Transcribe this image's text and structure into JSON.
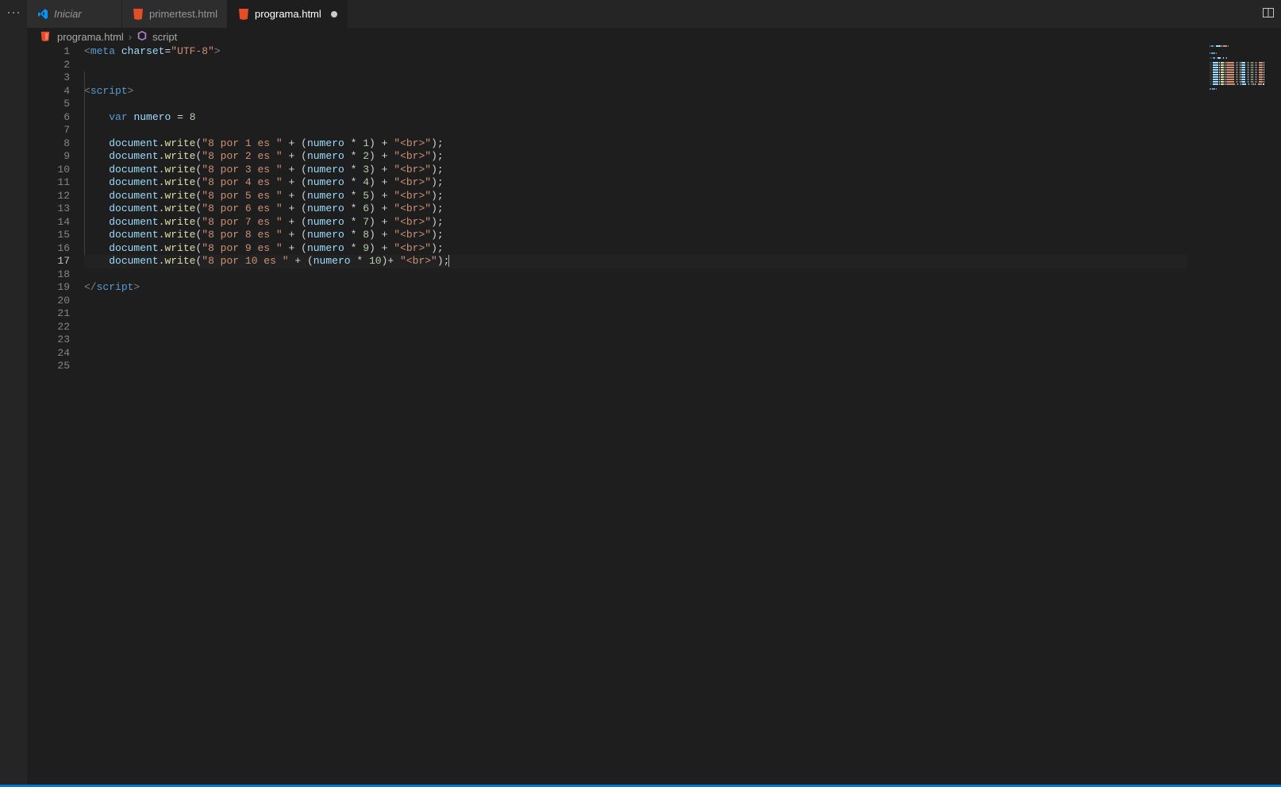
{
  "tabs": [
    {
      "label": "Iniciar",
      "icon": "vscode",
      "italic": true,
      "active": false,
      "dirty": false
    },
    {
      "label": "primertest.html",
      "icon": "html",
      "italic": false,
      "active": false,
      "dirty": false
    },
    {
      "label": "programa.html",
      "icon": "html",
      "italic": false,
      "active": true,
      "dirty": true
    }
  ],
  "breadcrumbs": {
    "file_icon": "html",
    "file": "programa.html",
    "symbol_icon": "cube",
    "symbol": "script"
  },
  "editor": {
    "current_line": 17,
    "total_lines": 25,
    "code_lines": [
      {
        "n": 1,
        "tokens": [
          {
            "c": "tk-tag",
            "t": "<"
          },
          {
            "c": "tk-tagname",
            "t": "meta"
          },
          {
            "c": "tk-plain",
            "t": " "
          },
          {
            "c": "tk-attr",
            "t": "charset"
          },
          {
            "c": "tk-op",
            "t": "="
          },
          {
            "c": "tk-str",
            "t": "\"UTF-8\""
          },
          {
            "c": "tk-tag",
            "t": ">"
          }
        ]
      },
      {
        "n": 2,
        "tokens": []
      },
      {
        "n": 3,
        "tokens": []
      },
      {
        "n": 4,
        "tokens": [
          {
            "c": "tk-tag",
            "t": "<"
          },
          {
            "c": "tk-tagname",
            "t": "script"
          },
          {
            "c": "tk-tag",
            "t": ">"
          }
        ]
      },
      {
        "n": 5,
        "tokens": []
      },
      {
        "n": 6,
        "tokens": [
          {
            "c": "tk-plain",
            "t": "    "
          },
          {
            "c": "tk-kw",
            "t": "var"
          },
          {
            "c": "tk-plain",
            "t": " "
          },
          {
            "c": "tk-var",
            "t": "numero"
          },
          {
            "c": "tk-plain",
            "t": " "
          },
          {
            "c": "tk-op",
            "t": "="
          },
          {
            "c": "tk-plain",
            "t": " "
          },
          {
            "c": "tk-num",
            "t": "8"
          }
        ]
      },
      {
        "n": 7,
        "tokens": []
      },
      {
        "n": 8,
        "tokens": [
          {
            "c": "tk-plain",
            "t": "    "
          },
          {
            "c": "tk-obj",
            "t": "document"
          },
          {
            "c": "tk-punc",
            "t": "."
          },
          {
            "c": "tk-fn",
            "t": "write"
          },
          {
            "c": "tk-punc",
            "t": "("
          },
          {
            "c": "tk-str",
            "t": "\"8 por 1 es \""
          },
          {
            "c": "tk-plain",
            "t": " "
          },
          {
            "c": "tk-op",
            "t": "+"
          },
          {
            "c": "tk-plain",
            "t": " "
          },
          {
            "c": "tk-punc",
            "t": "("
          },
          {
            "c": "tk-var",
            "t": "numero"
          },
          {
            "c": "tk-plain",
            "t": " "
          },
          {
            "c": "tk-op",
            "t": "*"
          },
          {
            "c": "tk-plain",
            "t": " "
          },
          {
            "c": "tk-num",
            "t": "1"
          },
          {
            "c": "tk-punc",
            "t": ")"
          },
          {
            "c": "tk-plain",
            "t": " "
          },
          {
            "c": "tk-op",
            "t": "+"
          },
          {
            "c": "tk-plain",
            "t": " "
          },
          {
            "c": "tk-str",
            "t": "\"<br>\""
          },
          {
            "c": "tk-punc",
            "t": ");"
          }
        ]
      },
      {
        "n": 9,
        "tokens": [
          {
            "c": "tk-plain",
            "t": "    "
          },
          {
            "c": "tk-obj",
            "t": "document"
          },
          {
            "c": "tk-punc",
            "t": "."
          },
          {
            "c": "tk-fn",
            "t": "write"
          },
          {
            "c": "tk-punc",
            "t": "("
          },
          {
            "c": "tk-str",
            "t": "\"8 por 2 es \""
          },
          {
            "c": "tk-plain",
            "t": " "
          },
          {
            "c": "tk-op",
            "t": "+"
          },
          {
            "c": "tk-plain",
            "t": " "
          },
          {
            "c": "tk-punc",
            "t": "("
          },
          {
            "c": "tk-var",
            "t": "numero"
          },
          {
            "c": "tk-plain",
            "t": " "
          },
          {
            "c": "tk-op",
            "t": "*"
          },
          {
            "c": "tk-plain",
            "t": " "
          },
          {
            "c": "tk-num",
            "t": "2"
          },
          {
            "c": "tk-punc",
            "t": ")"
          },
          {
            "c": "tk-plain",
            "t": " "
          },
          {
            "c": "tk-op",
            "t": "+"
          },
          {
            "c": "tk-plain",
            "t": " "
          },
          {
            "c": "tk-str",
            "t": "\"<br>\""
          },
          {
            "c": "tk-punc",
            "t": ");"
          }
        ]
      },
      {
        "n": 10,
        "tokens": [
          {
            "c": "tk-plain",
            "t": "    "
          },
          {
            "c": "tk-obj",
            "t": "document"
          },
          {
            "c": "tk-punc",
            "t": "."
          },
          {
            "c": "tk-fn",
            "t": "write"
          },
          {
            "c": "tk-punc",
            "t": "("
          },
          {
            "c": "tk-str",
            "t": "\"8 por 3 es \""
          },
          {
            "c": "tk-plain",
            "t": " "
          },
          {
            "c": "tk-op",
            "t": "+"
          },
          {
            "c": "tk-plain",
            "t": " "
          },
          {
            "c": "tk-punc",
            "t": "("
          },
          {
            "c": "tk-var",
            "t": "numero"
          },
          {
            "c": "tk-plain",
            "t": " "
          },
          {
            "c": "tk-op",
            "t": "*"
          },
          {
            "c": "tk-plain",
            "t": " "
          },
          {
            "c": "tk-num",
            "t": "3"
          },
          {
            "c": "tk-punc",
            "t": ")"
          },
          {
            "c": "tk-plain",
            "t": " "
          },
          {
            "c": "tk-op",
            "t": "+"
          },
          {
            "c": "tk-plain",
            "t": " "
          },
          {
            "c": "tk-str",
            "t": "\"<br>\""
          },
          {
            "c": "tk-punc",
            "t": ");"
          }
        ]
      },
      {
        "n": 11,
        "tokens": [
          {
            "c": "tk-plain",
            "t": "    "
          },
          {
            "c": "tk-obj",
            "t": "document"
          },
          {
            "c": "tk-punc",
            "t": "."
          },
          {
            "c": "tk-fn",
            "t": "write"
          },
          {
            "c": "tk-punc",
            "t": "("
          },
          {
            "c": "tk-str",
            "t": "\"8 por 4 es \""
          },
          {
            "c": "tk-plain",
            "t": " "
          },
          {
            "c": "tk-op",
            "t": "+"
          },
          {
            "c": "tk-plain",
            "t": " "
          },
          {
            "c": "tk-punc",
            "t": "("
          },
          {
            "c": "tk-var",
            "t": "numero"
          },
          {
            "c": "tk-plain",
            "t": " "
          },
          {
            "c": "tk-op",
            "t": "*"
          },
          {
            "c": "tk-plain",
            "t": " "
          },
          {
            "c": "tk-num",
            "t": "4"
          },
          {
            "c": "tk-punc",
            "t": ")"
          },
          {
            "c": "tk-plain",
            "t": " "
          },
          {
            "c": "tk-op",
            "t": "+"
          },
          {
            "c": "tk-plain",
            "t": " "
          },
          {
            "c": "tk-str",
            "t": "\"<br>\""
          },
          {
            "c": "tk-punc",
            "t": ");"
          }
        ]
      },
      {
        "n": 12,
        "tokens": [
          {
            "c": "tk-plain",
            "t": "    "
          },
          {
            "c": "tk-obj",
            "t": "document"
          },
          {
            "c": "tk-punc",
            "t": "."
          },
          {
            "c": "tk-fn",
            "t": "write"
          },
          {
            "c": "tk-punc",
            "t": "("
          },
          {
            "c": "tk-str",
            "t": "\"8 por 5 es \""
          },
          {
            "c": "tk-plain",
            "t": " "
          },
          {
            "c": "tk-op",
            "t": "+"
          },
          {
            "c": "tk-plain",
            "t": " "
          },
          {
            "c": "tk-punc",
            "t": "("
          },
          {
            "c": "tk-var",
            "t": "numero"
          },
          {
            "c": "tk-plain",
            "t": " "
          },
          {
            "c": "tk-op",
            "t": "*"
          },
          {
            "c": "tk-plain",
            "t": " "
          },
          {
            "c": "tk-num",
            "t": "5"
          },
          {
            "c": "tk-punc",
            "t": ")"
          },
          {
            "c": "tk-plain",
            "t": " "
          },
          {
            "c": "tk-op",
            "t": "+"
          },
          {
            "c": "tk-plain",
            "t": " "
          },
          {
            "c": "tk-str",
            "t": "\"<br>\""
          },
          {
            "c": "tk-punc",
            "t": ");"
          }
        ]
      },
      {
        "n": 13,
        "tokens": [
          {
            "c": "tk-plain",
            "t": "    "
          },
          {
            "c": "tk-obj",
            "t": "document"
          },
          {
            "c": "tk-punc",
            "t": "."
          },
          {
            "c": "tk-fn",
            "t": "write"
          },
          {
            "c": "tk-punc",
            "t": "("
          },
          {
            "c": "tk-str",
            "t": "\"8 por 6 es \""
          },
          {
            "c": "tk-plain",
            "t": " "
          },
          {
            "c": "tk-op",
            "t": "+"
          },
          {
            "c": "tk-plain",
            "t": " "
          },
          {
            "c": "tk-punc",
            "t": "("
          },
          {
            "c": "tk-var",
            "t": "numero"
          },
          {
            "c": "tk-plain",
            "t": " "
          },
          {
            "c": "tk-op",
            "t": "*"
          },
          {
            "c": "tk-plain",
            "t": " "
          },
          {
            "c": "tk-num",
            "t": "6"
          },
          {
            "c": "tk-punc",
            "t": ")"
          },
          {
            "c": "tk-plain",
            "t": " "
          },
          {
            "c": "tk-op",
            "t": "+"
          },
          {
            "c": "tk-plain",
            "t": " "
          },
          {
            "c": "tk-str",
            "t": "\"<br>\""
          },
          {
            "c": "tk-punc",
            "t": ");"
          }
        ]
      },
      {
        "n": 14,
        "tokens": [
          {
            "c": "tk-plain",
            "t": "    "
          },
          {
            "c": "tk-obj",
            "t": "document"
          },
          {
            "c": "tk-punc",
            "t": "."
          },
          {
            "c": "tk-fn",
            "t": "write"
          },
          {
            "c": "tk-punc",
            "t": "("
          },
          {
            "c": "tk-str",
            "t": "\"8 por 7 es \""
          },
          {
            "c": "tk-plain",
            "t": " "
          },
          {
            "c": "tk-op",
            "t": "+"
          },
          {
            "c": "tk-plain",
            "t": " "
          },
          {
            "c": "tk-punc",
            "t": "("
          },
          {
            "c": "tk-var",
            "t": "numero"
          },
          {
            "c": "tk-plain",
            "t": " "
          },
          {
            "c": "tk-op",
            "t": "*"
          },
          {
            "c": "tk-plain",
            "t": " "
          },
          {
            "c": "tk-num",
            "t": "7"
          },
          {
            "c": "tk-punc",
            "t": ")"
          },
          {
            "c": "tk-plain",
            "t": " "
          },
          {
            "c": "tk-op",
            "t": "+"
          },
          {
            "c": "tk-plain",
            "t": " "
          },
          {
            "c": "tk-str",
            "t": "\"<br>\""
          },
          {
            "c": "tk-punc",
            "t": ");"
          }
        ]
      },
      {
        "n": 15,
        "tokens": [
          {
            "c": "tk-plain",
            "t": "    "
          },
          {
            "c": "tk-obj",
            "t": "document"
          },
          {
            "c": "tk-punc",
            "t": "."
          },
          {
            "c": "tk-fn",
            "t": "write"
          },
          {
            "c": "tk-punc",
            "t": "("
          },
          {
            "c": "tk-str",
            "t": "\"8 por 8 es \""
          },
          {
            "c": "tk-plain",
            "t": " "
          },
          {
            "c": "tk-op",
            "t": "+"
          },
          {
            "c": "tk-plain",
            "t": " "
          },
          {
            "c": "tk-punc",
            "t": "("
          },
          {
            "c": "tk-var",
            "t": "numero"
          },
          {
            "c": "tk-plain",
            "t": " "
          },
          {
            "c": "tk-op",
            "t": "*"
          },
          {
            "c": "tk-plain",
            "t": " "
          },
          {
            "c": "tk-num",
            "t": "8"
          },
          {
            "c": "tk-punc",
            "t": ")"
          },
          {
            "c": "tk-plain",
            "t": " "
          },
          {
            "c": "tk-op",
            "t": "+"
          },
          {
            "c": "tk-plain",
            "t": " "
          },
          {
            "c": "tk-str",
            "t": "\"<br>\""
          },
          {
            "c": "tk-punc",
            "t": ");"
          }
        ]
      },
      {
        "n": 16,
        "tokens": [
          {
            "c": "tk-plain",
            "t": "    "
          },
          {
            "c": "tk-obj",
            "t": "document"
          },
          {
            "c": "tk-punc",
            "t": "."
          },
          {
            "c": "tk-fn",
            "t": "write"
          },
          {
            "c": "tk-punc",
            "t": "("
          },
          {
            "c": "tk-str",
            "t": "\"8 por 9 es \""
          },
          {
            "c": "tk-plain",
            "t": " "
          },
          {
            "c": "tk-op",
            "t": "+"
          },
          {
            "c": "tk-plain",
            "t": " "
          },
          {
            "c": "tk-punc",
            "t": "("
          },
          {
            "c": "tk-var",
            "t": "numero"
          },
          {
            "c": "tk-plain",
            "t": " "
          },
          {
            "c": "tk-op",
            "t": "*"
          },
          {
            "c": "tk-plain",
            "t": " "
          },
          {
            "c": "tk-num",
            "t": "9"
          },
          {
            "c": "tk-punc",
            "t": ")"
          },
          {
            "c": "tk-plain",
            "t": " "
          },
          {
            "c": "tk-op",
            "t": "+"
          },
          {
            "c": "tk-plain",
            "t": " "
          },
          {
            "c": "tk-str",
            "t": "\"<br>\""
          },
          {
            "c": "tk-punc",
            "t": ");"
          }
        ]
      },
      {
        "n": 17,
        "tokens": [
          {
            "c": "tk-plain",
            "t": "    "
          },
          {
            "c": "tk-obj",
            "t": "document"
          },
          {
            "c": "tk-punc",
            "t": "."
          },
          {
            "c": "tk-fn",
            "t": "write"
          },
          {
            "c": "tk-punc",
            "t": "("
          },
          {
            "c": "tk-str",
            "t": "\"8 por 10 es \""
          },
          {
            "c": "tk-plain",
            "t": " "
          },
          {
            "c": "tk-op",
            "t": "+"
          },
          {
            "c": "tk-plain",
            "t": " "
          },
          {
            "c": "tk-punc",
            "t": "("
          },
          {
            "c": "tk-var",
            "t": "numero"
          },
          {
            "c": "tk-plain",
            "t": " "
          },
          {
            "c": "tk-op",
            "t": "*"
          },
          {
            "c": "tk-plain",
            "t": " "
          },
          {
            "c": "tk-num",
            "t": "10"
          },
          {
            "c": "tk-punc",
            "t": ")"
          },
          {
            "c": "tk-op",
            "t": "+"
          },
          {
            "c": "tk-plain",
            "t": " "
          },
          {
            "c": "tk-str",
            "t": "\"<br>\""
          },
          {
            "c": "tk-punc",
            "t": ");"
          }
        ],
        "cursor_after": true
      },
      {
        "n": 18,
        "tokens": []
      },
      {
        "n": 19,
        "tokens": [
          {
            "c": "tk-tag",
            "t": "</"
          },
          {
            "c": "tk-tagname",
            "t": "script"
          },
          {
            "c": "tk-tag",
            "t": ">"
          }
        ]
      },
      {
        "n": 20,
        "tokens": []
      },
      {
        "n": 21,
        "tokens": []
      },
      {
        "n": 22,
        "tokens": []
      },
      {
        "n": 23,
        "tokens": []
      },
      {
        "n": 24,
        "tokens": []
      },
      {
        "n": 25,
        "tokens": []
      }
    ]
  }
}
